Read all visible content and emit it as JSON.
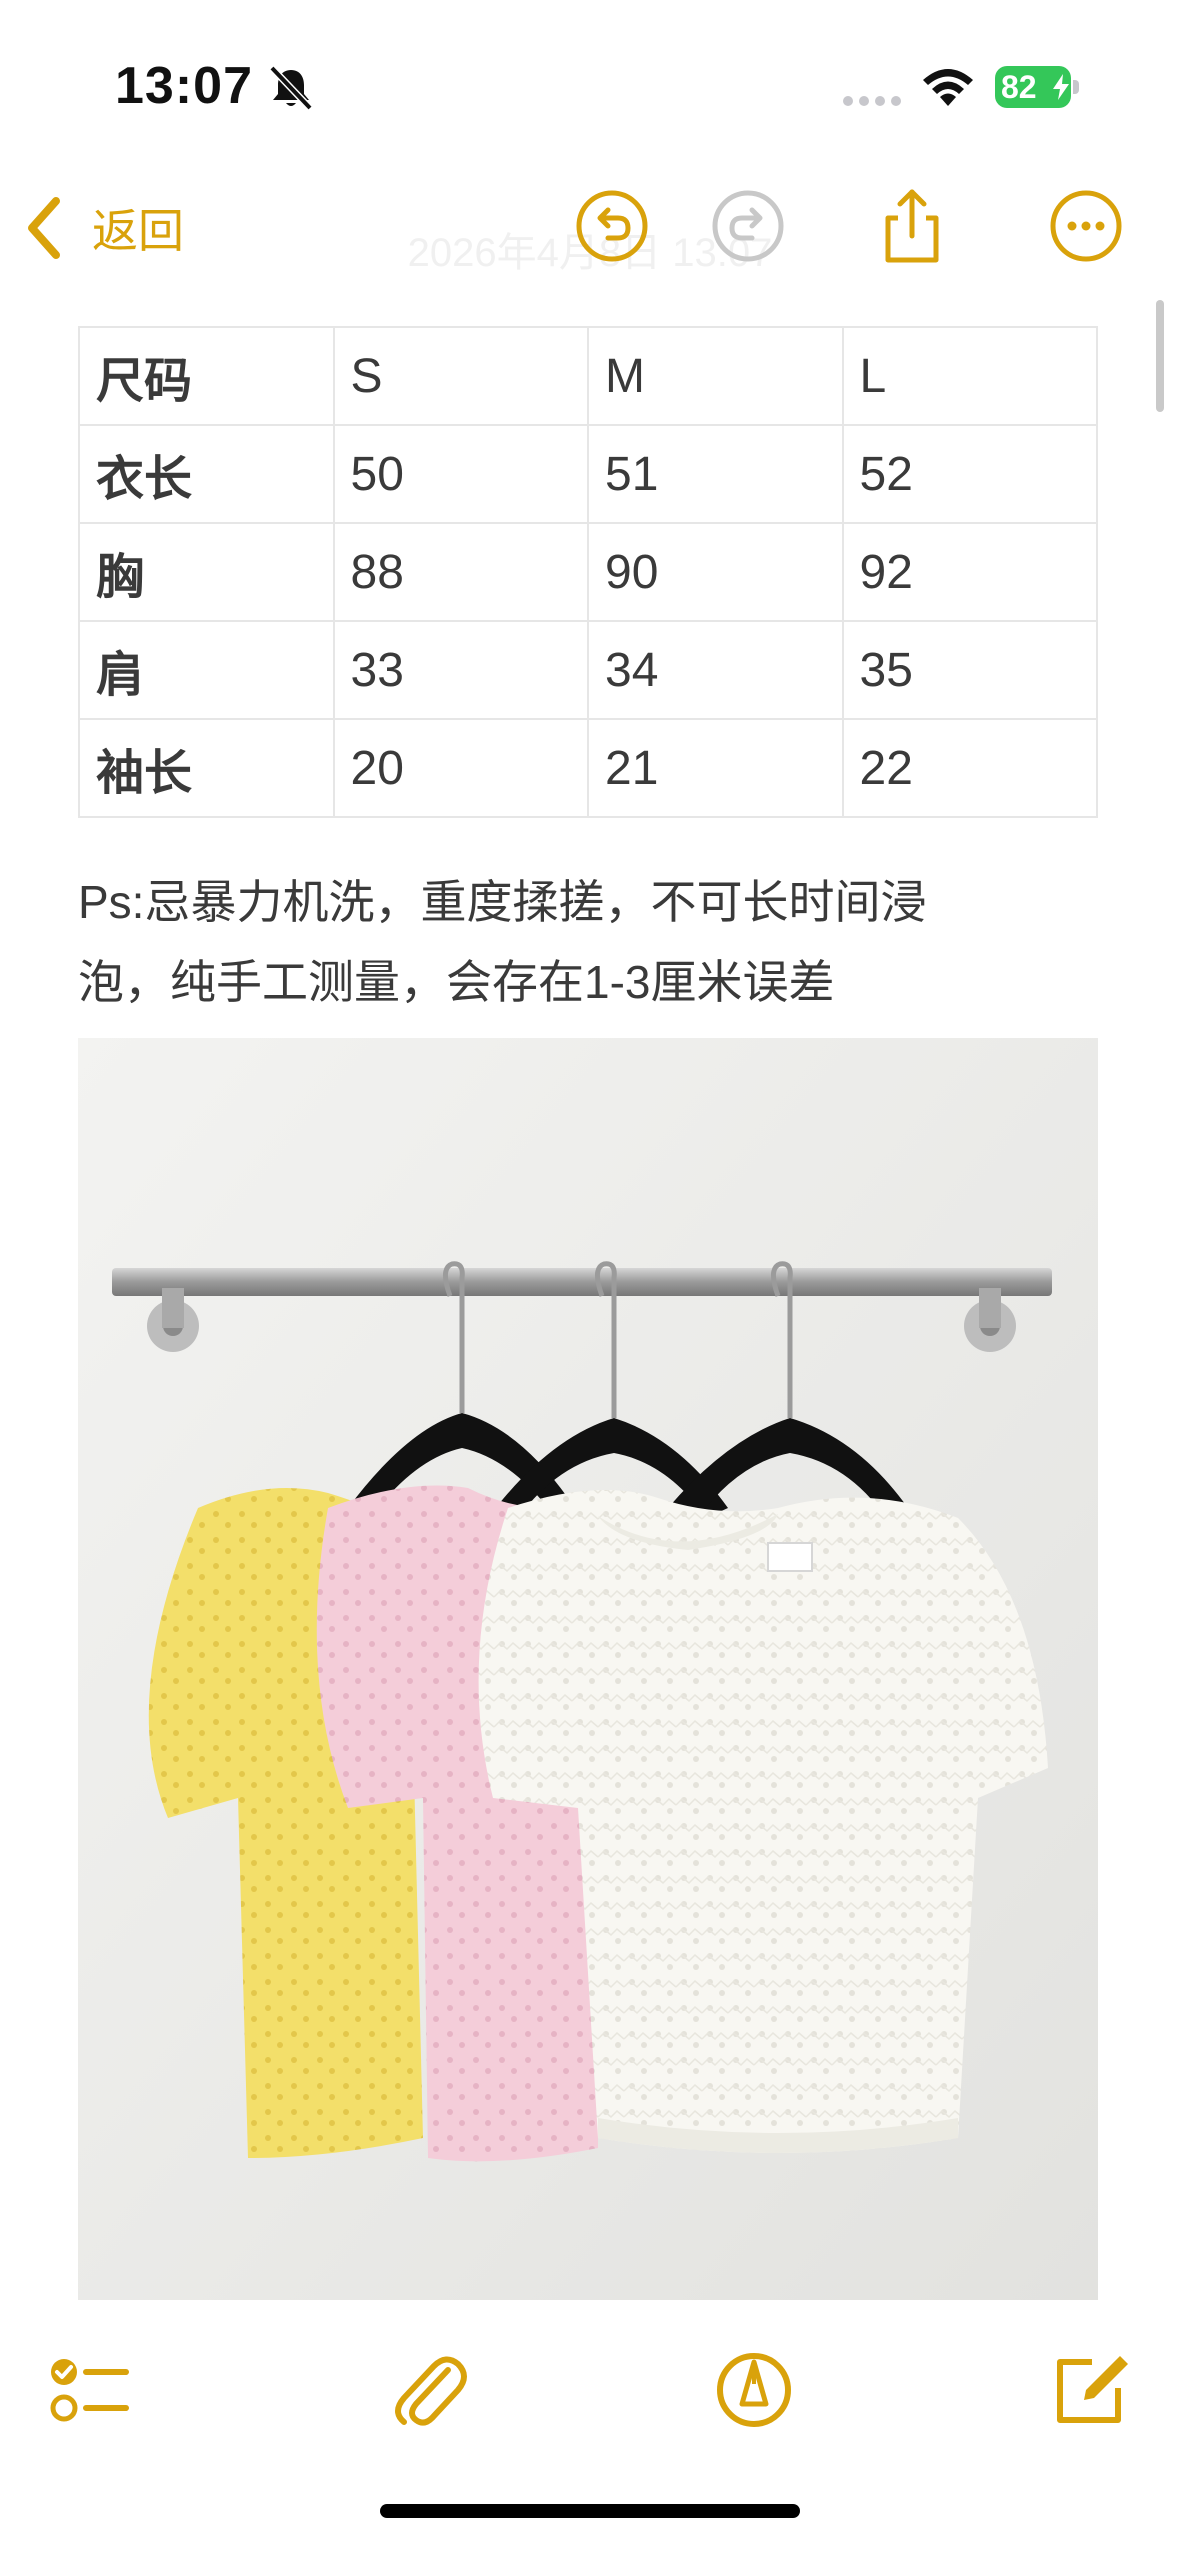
{
  "status_bar": {
    "time": "13:07",
    "battery_level": "82"
  },
  "nav": {
    "back_label": "返回",
    "faded_date": "2026年4月8日 13:07"
  },
  "size_table": {
    "rows": [
      [
        "尺码",
        "S",
        "M",
        "L"
      ],
      [
        "衣长",
        "50",
        "51",
        "52"
      ],
      [
        "胸",
        "88",
        "90",
        "92"
      ],
      [
        "肩",
        "33",
        "34",
        "35"
      ],
      [
        "袖长",
        "20",
        "21",
        "22"
      ]
    ]
  },
  "note": {
    "line1": "Ps:忌暴力机洗，重度揉搓，不可长时间浸",
    "line2": "泡，纯手工测量，会存在1-3厘米误差"
  },
  "colors": {
    "accent": "#d9a20b",
    "battery": "#34c759"
  }
}
